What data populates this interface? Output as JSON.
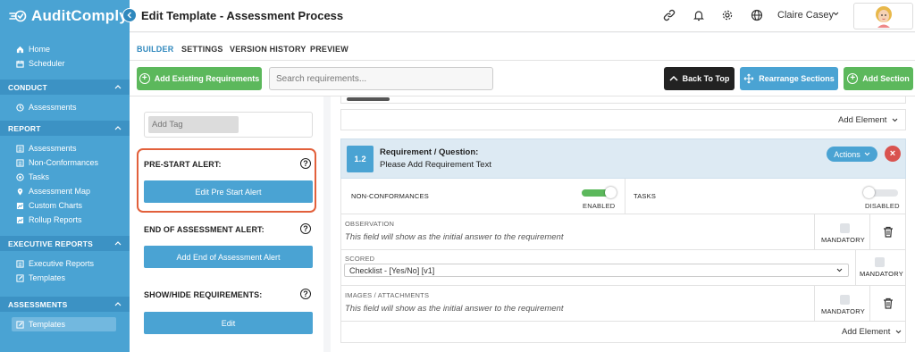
{
  "app": {
    "name": "AuditComply"
  },
  "sidebar": {
    "top_items": [
      {
        "label": "Home",
        "icon": "home-icon"
      },
      {
        "label": "Scheduler",
        "icon": "calendar-icon"
      }
    ],
    "sections": [
      {
        "title": "CONDUCT",
        "items": [
          {
            "label": "Assessments",
            "icon": "clock-icon"
          }
        ]
      },
      {
        "title": "REPORT",
        "items": [
          {
            "label": "Assessments",
            "icon": "list-icon"
          },
          {
            "label": "Non-Conformances",
            "icon": "list-icon"
          },
          {
            "label": "Tasks",
            "icon": "tasks-icon"
          },
          {
            "label": "Assessment Map",
            "icon": "map-pin-icon"
          },
          {
            "label": "Custom Charts",
            "icon": "chart-icon"
          },
          {
            "label": "Rollup Reports",
            "icon": "chart-icon"
          }
        ]
      },
      {
        "title": "EXECUTIVE REPORTS",
        "items": [
          {
            "label": "Executive Reports",
            "icon": "list-icon"
          },
          {
            "label": "Templates",
            "icon": "edit-icon"
          }
        ]
      },
      {
        "title": "ASSESSMENTS",
        "items": [
          {
            "label": "Templates",
            "icon": "edit-icon"
          }
        ]
      }
    ]
  },
  "header": {
    "title": "Edit Template - Assessment Process",
    "user_name": "Claire Casey"
  },
  "tabs": [
    "BUILDER",
    "SETTINGS",
    "VERSION HISTORY",
    "PREVIEW"
  ],
  "toolbar": {
    "add_existing": "Add Existing Requirements",
    "search_placeholder": "Search requirements...",
    "back_to_top": "Back To Top",
    "rearrange": "Rearrange Sections",
    "add_section": "Add Section"
  },
  "left_panel": {
    "tag_placeholder": "Add Tag",
    "pre_start_label": "PRE-START ALERT:",
    "pre_start_button": "Edit Pre Start Alert",
    "end_label": "END OF ASSESSMENT ALERT:",
    "end_button": "Add End of Assessment Alert",
    "show_hide_label": "SHOW/HIDE REQUIREMENTS:",
    "edit_button": "Edit",
    "help_glyph": "?"
  },
  "main": {
    "add_element": "Add Element",
    "requirement": {
      "number": "1.2",
      "label": "Requirement / Question:",
      "text": "Please Add Requirement Text",
      "actions": "Actions"
    },
    "non_conformances": {
      "label": "NON-CONFORMANCES",
      "state": "ENABLED",
      "on": true
    },
    "tasks": {
      "label": "TASKS",
      "state": "DISABLED",
      "on": false
    },
    "fields": [
      {
        "label": "OBSERVATION",
        "hint": "This field will show as the initial answer to the requirement",
        "mandatory": "MANDATORY"
      },
      {
        "label": "SCORED",
        "value": "Checklist - [Yes/No] [v1]",
        "mandatory": "MANDATORY"
      },
      {
        "label": "IMAGES / ATTACHMENTS",
        "hint": "This field will show as the initial answer to the requirement",
        "mandatory": "MANDATORY"
      }
    ]
  },
  "colors": {
    "brand": "#4aa3d3",
    "green": "#5cb85c",
    "highlight": "#e2603b",
    "danger": "#d9534f"
  }
}
